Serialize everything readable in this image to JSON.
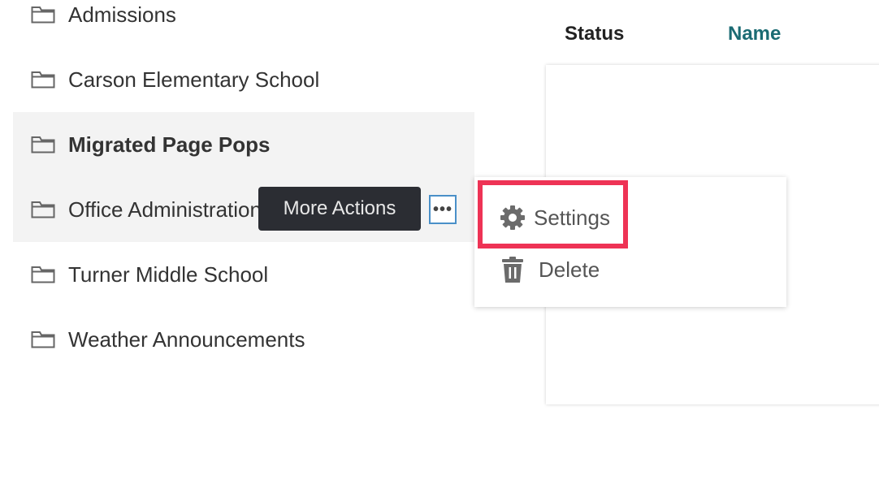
{
  "folders": [
    {
      "label": "Admissions"
    },
    {
      "label": "Carson Elementary School"
    },
    {
      "label": "Migrated Page Pops"
    },
    {
      "label": "Office Administration"
    },
    {
      "label": "Turner Middle School"
    },
    {
      "label": "Weather Announcements"
    }
  ],
  "more_button": {
    "glyph": "•••",
    "icon": "ellipsis-icon"
  },
  "tooltip": {
    "text": "More Actions"
  },
  "table_header": {
    "status": "Status",
    "name": "Name"
  },
  "menu": {
    "settings": {
      "label": "Settings",
      "icon": "gear-icon"
    },
    "delete": {
      "label": "Delete",
      "icon": "trash-icon"
    }
  },
  "colors": {
    "accent_teal": "#1b6b73",
    "focus_outline": "#ee3355",
    "button_border": "#4a90c8",
    "tooltip_bg": "#2b2d33",
    "row_highlight": "#f3f3f3"
  }
}
